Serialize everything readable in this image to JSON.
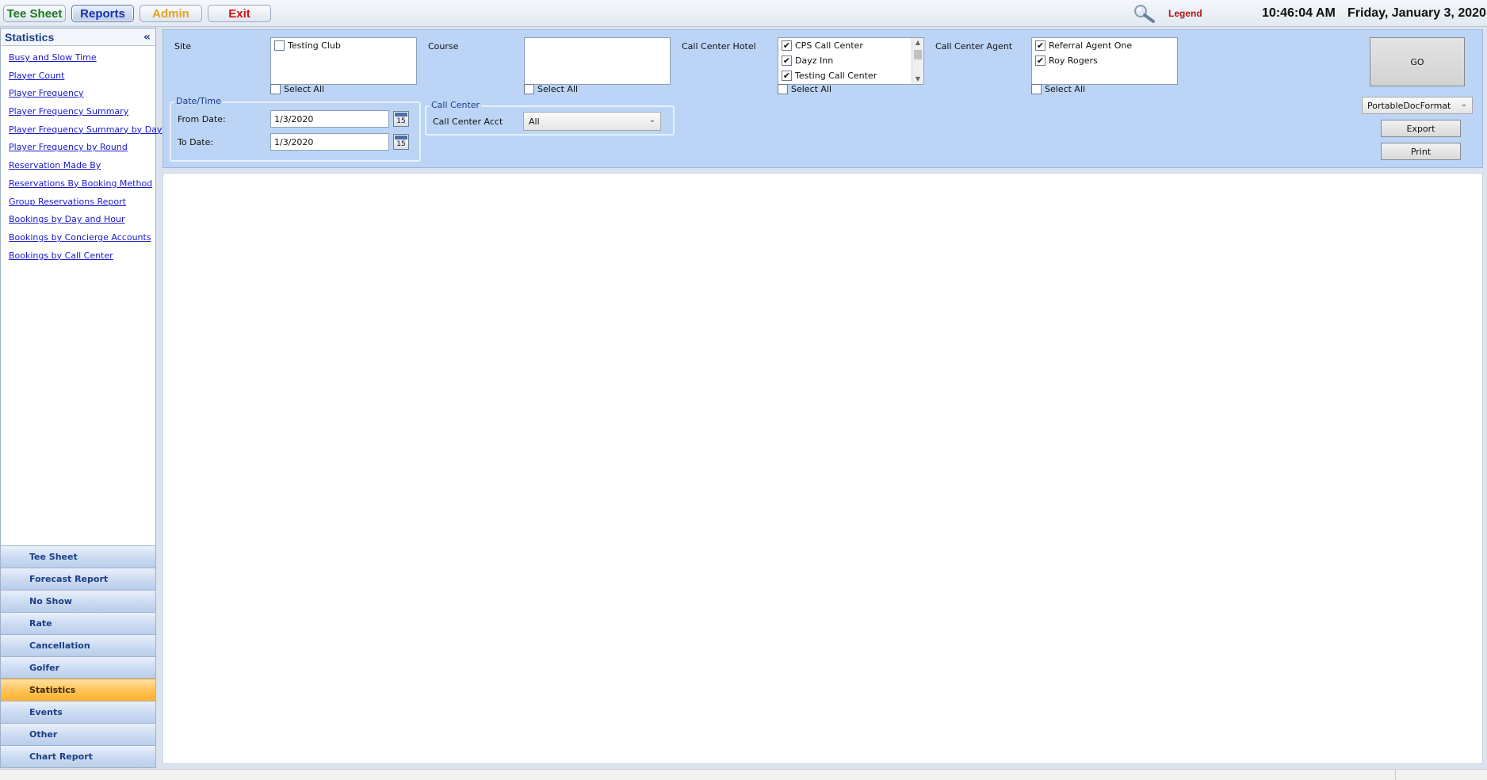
{
  "nav": {
    "tee_sheet": "Tee Sheet",
    "reports": "Reports",
    "admin": "Admin",
    "exit": "Exit"
  },
  "header": {
    "legend": "Legend",
    "time": "10:46:04 AM",
    "date": "Friday, January 3, 2020",
    "colors": {
      "tee": "#1b7a1b",
      "reports": "#1a2fb0",
      "admin": "#e6a21a",
      "exit": "#d51313",
      "legend": "#b21515"
    }
  },
  "sidebar": {
    "title": "Statistics",
    "collapse_glyph": "«",
    "links": [
      "Busy and Slow Time",
      "Player Count",
      "Player Frequency",
      "Player Frequency Summary",
      "Player Frequency Summary by Day",
      "Player Frequency by Round",
      "Reservation Made By",
      "Reservations By Booking Method",
      "Group Reservations Report",
      "Bookings by Day and Hour",
      "Bookings by Concierge Accounts",
      "Bookings by Call Center"
    ],
    "categories": [
      "Tee Sheet",
      "Forecast Report",
      "No Show",
      "Rate",
      "Cancellation",
      "Golfer",
      "Statistics",
      "Events",
      "Other",
      "Chart Report"
    ],
    "active_category": "Statistics"
  },
  "filters": {
    "site_label": "Site",
    "site_items": [
      {
        "label": "Testing Club",
        "checked": false
      }
    ],
    "course_label": "Course",
    "course_items": [],
    "hotel_label": "Call Center Hotel",
    "hotel_items": [
      {
        "label": "CPS Call Center",
        "checked": true
      },
      {
        "label": "Dayz Inn",
        "checked": true
      },
      {
        "label": "Testing Call Center",
        "checked": true
      }
    ],
    "agent_label": "Call Center Agent",
    "agent_items": [
      {
        "label": "Referral Agent One",
        "checked": true
      },
      {
        "label": "Roy Rogers",
        "checked": true
      }
    ],
    "select_all": "Select All",
    "datetime_group": "Date/Time",
    "from_label": "From Date:",
    "from_value": "1/3/2020",
    "to_label": "To Date:",
    "to_value": "1/3/2020",
    "calendar_day": "15",
    "callcenter_group": "Call Center",
    "acct_label": "Call Center Acct",
    "acct_value": "All",
    "go": "GO",
    "format_value": "PortableDocFormat",
    "export": "Export",
    "print": "Print"
  }
}
